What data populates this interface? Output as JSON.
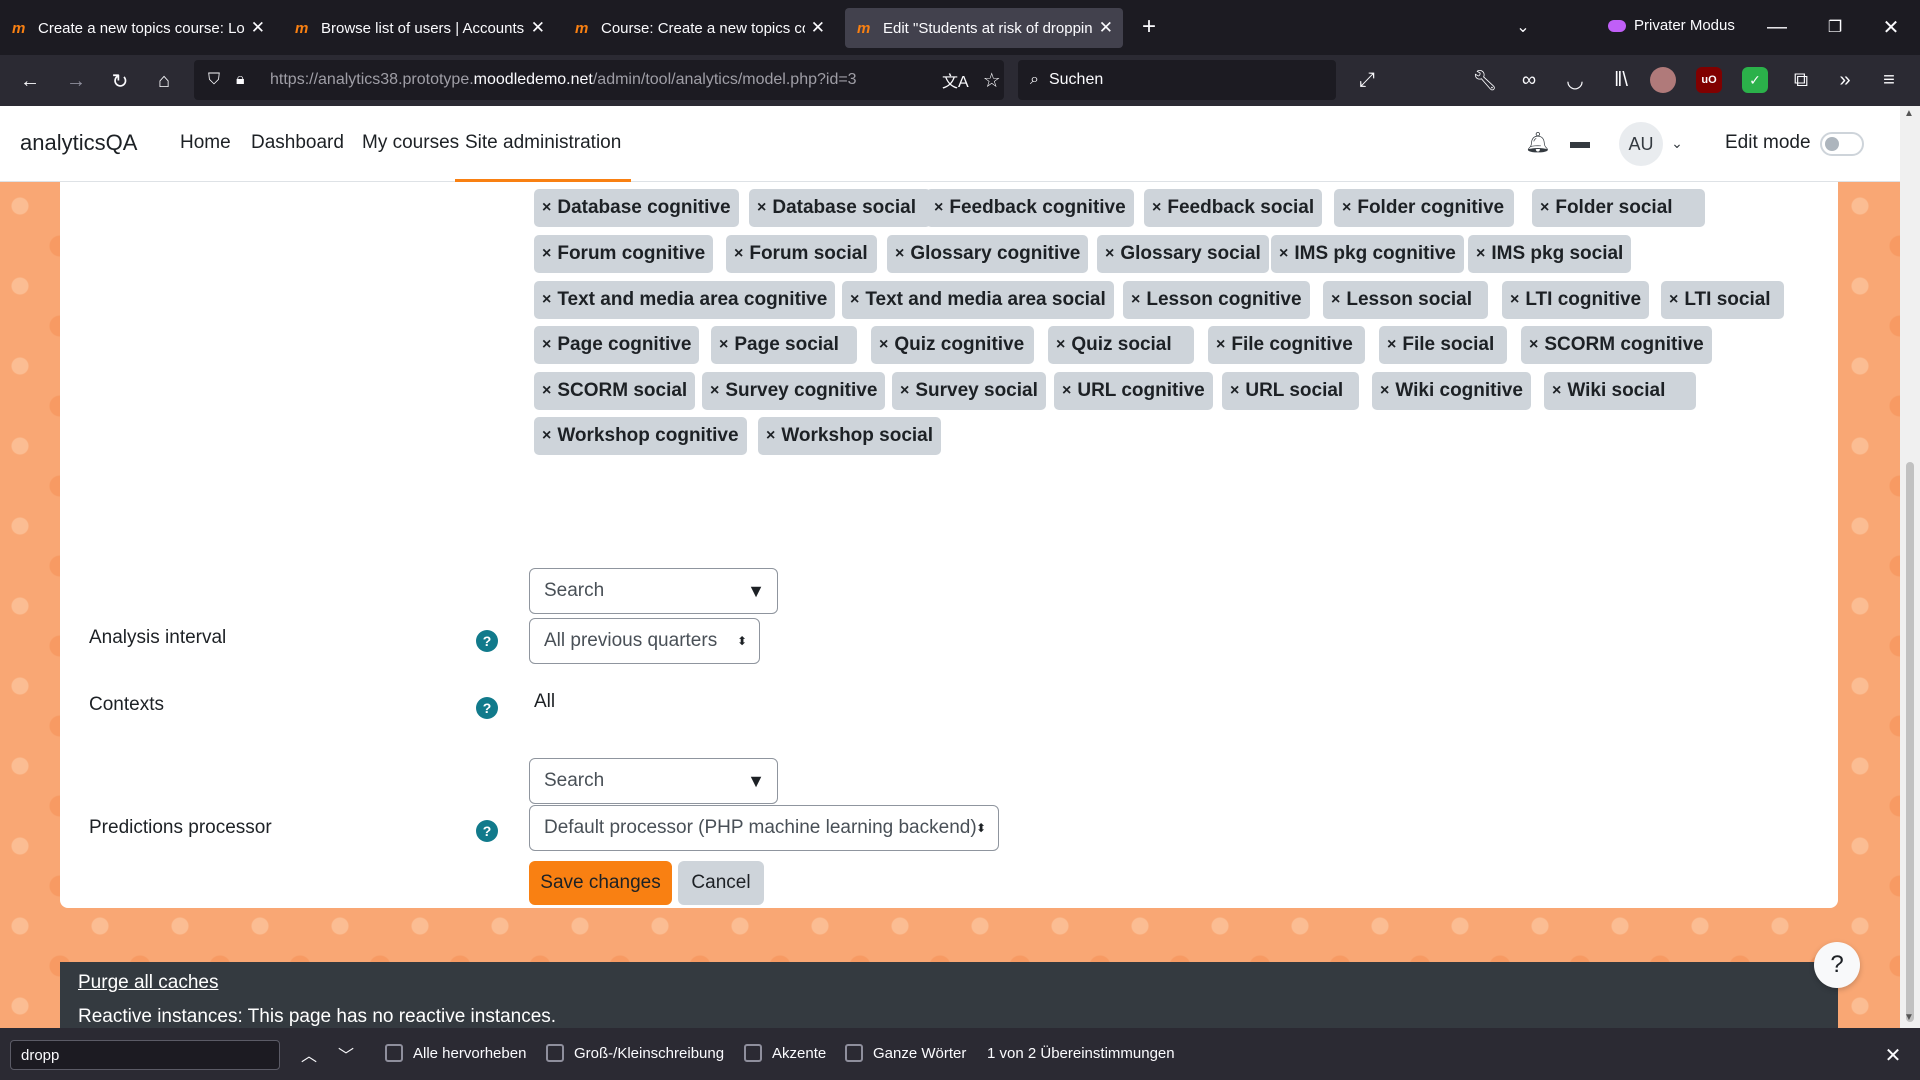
{
  "browser": {
    "tabs": [
      {
        "label": "Create a new topics course: Log",
        "active": false
      },
      {
        "label": "Browse list of users | Accounts |",
        "active": false
      },
      {
        "label": "Course: Create a new topics cou",
        "active": false
      },
      {
        "label": "Edit \"Students at risk of droppin",
        "active": true
      }
    ],
    "private_label": "Privater Modus",
    "url_prefix": "https://analytics38.prototype.",
    "url_host": "moodledemo.net",
    "url_suffix": "/admin/tool/analytics/model.php?id=3",
    "search_placeholder": "Suchen"
  },
  "site": {
    "brand": "analyticsQA",
    "nav": [
      "Home",
      "Dashboard",
      "My courses",
      "Site administration"
    ],
    "active_nav": "Site administration",
    "avatar_initials": "AU",
    "edit_mode_label": "Edit mode"
  },
  "form": {
    "indicator_tags": [
      "Database cognitive",
      "Database social",
      "Feedback cognitive",
      "Feedback social",
      "Folder cognitive",
      "Folder social",
      "Forum cognitive",
      "Forum social",
      "Glossary cognitive",
      "Glossary social",
      "IMS pkg cognitive",
      "IMS pkg social",
      "Text and media area cognitive",
      "Text and media area social",
      "Lesson cognitive",
      "Lesson social",
      "LTI cognitive",
      "LTI social",
      "Page cognitive",
      "Page social",
      "Quiz cognitive",
      "Quiz social",
      "File cognitive",
      "File social",
      "SCORM cognitive",
      "SCORM social",
      "Survey cognitive",
      "Survey social",
      "URL cognitive",
      "URL social",
      "Wiki cognitive",
      "Wiki social",
      "Workshop cognitive",
      "Workshop social"
    ],
    "tag_remove_glyph": "×",
    "search_placeholder": "Search",
    "analysis_interval_label": "Analysis interval",
    "analysis_interval_value": "All previous quarters",
    "contexts_label": "Contexts",
    "contexts_value": "All",
    "contexts_search_placeholder": "Search",
    "predictions_processor_label": "Predictions processor",
    "predictions_processor_value": "Default processor (PHP machine learning backend)",
    "help_glyph": "?",
    "save_label": "Save changes",
    "cancel_label": "Cancel"
  },
  "footer": {
    "purge_link": "Purge all caches",
    "reactive_msg": "Reactive instances: This page has no reactive instances.",
    "help_glyph": "?"
  },
  "findbar": {
    "query": "dropp",
    "options": [
      "Alle hervorheben",
      "Groß-/Kleinschreibung",
      "Akzente",
      "Ganze Wörter"
    ],
    "status": "1 von 2 Übereinstimmungen"
  }
}
